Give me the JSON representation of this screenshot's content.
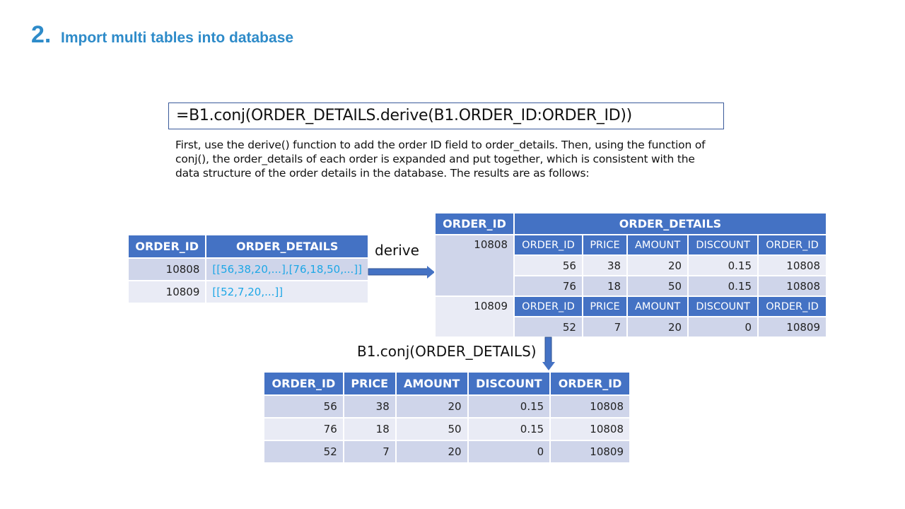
{
  "title": {
    "number": "2.",
    "text": "Import multi tables into database"
  },
  "formula": "=B1.conj(ORDER_DETAILS.derive(B1.ORDER_ID:ORDER_ID))",
  "description": "First, use the derive()  function to add the order ID field to order_details. Then, using the function of conj(), the order_details of each order is expanded and put together, which is consistent with the data structure of the order details in the database. The results are as follows:",
  "labels": {
    "derive": "derive",
    "conj": "B1.conj(ORDER_DETAILS)"
  },
  "source_table": {
    "headers": [
      "ORDER_ID",
      "ORDER_DETAILS"
    ],
    "rows": [
      [
        "10808",
        "[[56,38,20,...],[76,18,50,...]]"
      ],
      [
        "10809",
        "[[52,7,20,...]]"
      ]
    ]
  },
  "derived_table": {
    "headers": [
      "ORDER_ID",
      "ORDER_DETAILS"
    ],
    "sub_headers": [
      "ORDER_ID",
      "PRICE",
      "AMOUNT",
      "DISCOUNT",
      "ORDER_ID"
    ],
    "groups": [
      {
        "order_id": "10808",
        "rows": [
          [
            "56",
            "38",
            "20",
            "0.15",
            "10808"
          ],
          [
            "76",
            "18",
            "50",
            "0.15",
            "10808"
          ]
        ]
      },
      {
        "order_id": "10809",
        "rows": [
          [
            "52",
            "7",
            "20",
            "0",
            "10809"
          ]
        ]
      }
    ]
  },
  "result_table": {
    "headers": [
      "ORDER_ID",
      "PRICE",
      "AMOUNT",
      "DISCOUNT",
      "ORDER_ID"
    ],
    "rows": [
      [
        "56",
        "38",
        "20",
        "0.15",
        "10808"
      ],
      [
        "76",
        "18",
        "50",
        "0.15",
        "10808"
      ],
      [
        "52",
        "7",
        "20",
        "0",
        "10809"
      ]
    ]
  }
}
